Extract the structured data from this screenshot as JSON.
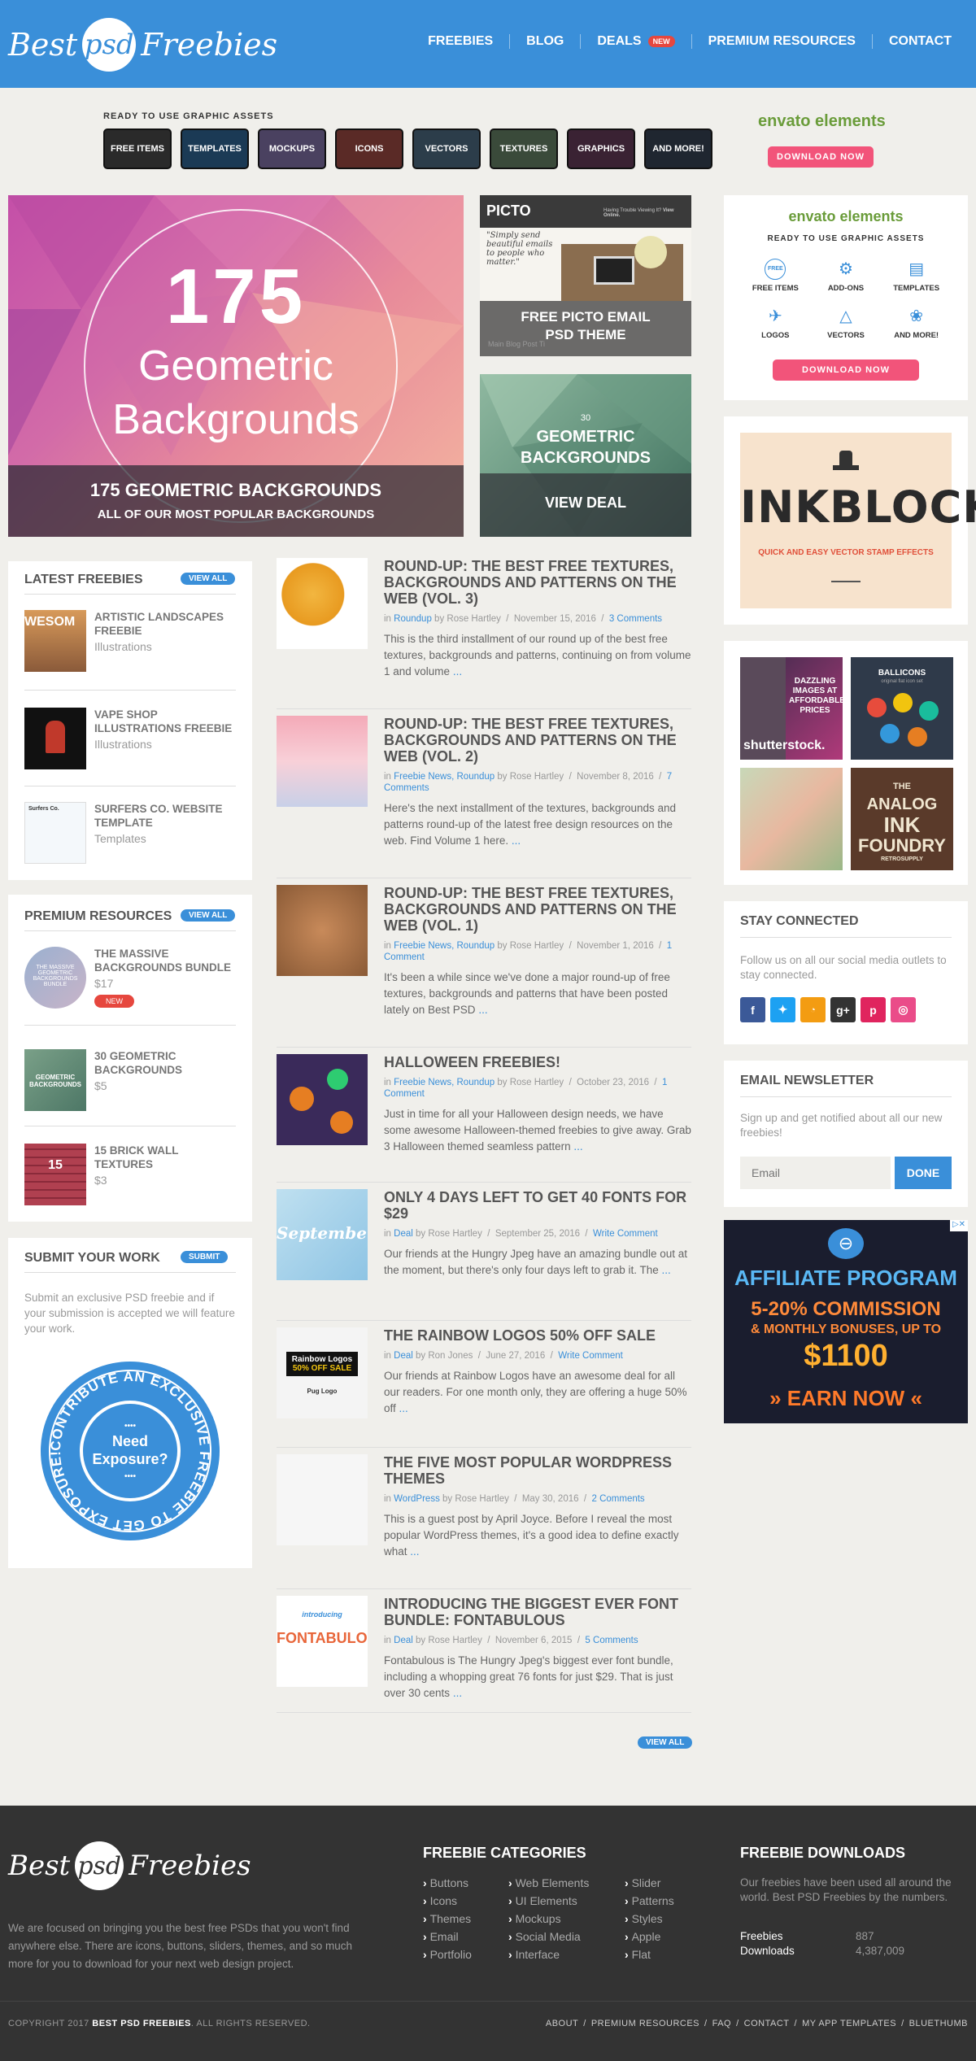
{
  "header": {
    "logo_left": "Best",
    "logo_mid": "psd",
    "logo_right": "Freebies",
    "nav": [
      {
        "label": "FREEBIES"
      },
      {
        "label": "BLOG"
      },
      {
        "label": "DEALS",
        "badge": "NEW"
      },
      {
        "label": "PREMIUM RESOURCES"
      },
      {
        "label": "CONTACT"
      }
    ]
  },
  "assets": {
    "label": "READY TO USE GRAPHIC ASSETS",
    "tiles": [
      "FREE ITEMS",
      "TEMPLATES",
      "MOCKUPS",
      "ICONS",
      "VECTORS",
      "TEXTURES",
      "GRAPHICS",
      "AND MORE!"
    ],
    "brand": "envato elements",
    "button": "DOWNLOAD NOW"
  },
  "hero": {
    "big": {
      "number": "175",
      "line1": "Geometric",
      "line2": "Backgrounds",
      "title": "175 GEOMETRIC BACKGROUNDS",
      "subtitle": "ALL OF OUR MOST POPULAR BACKGROUNDS"
    },
    "picto": {
      "brand": "PICTO",
      "tag": "Having Trouble Viewing It?",
      "tag2": "View Online.",
      "body": "\"Simply send beautiful emails to people who matter.\"",
      "title1": "FREE PICTO EMAIL",
      "title2": "PSD THEME",
      "footer": "Main Blog Post Ti"
    },
    "deal": {
      "small1": "30",
      "small2": "GEOMETRIC",
      "small3": "BACKGROUNDS",
      "title": "VIEW DEAL"
    }
  },
  "envato_panel": {
    "brand": "envato elements",
    "sub": "READY TO USE GRAPHIC ASSETS",
    "items": [
      "FREE ITEMS",
      "ADD-ONS",
      "TEMPLATES",
      "LOGOS",
      "VECTORS",
      "AND MORE!"
    ],
    "free": "FREE",
    "button": "DOWNLOAD NOW"
  },
  "inkblock": {
    "title": "INKBLOCK",
    "sub": "QUICK AND EASY VECTOR STAMP EFFECTS"
  },
  "ads": {
    "shutter1": "DAZZLING",
    "shutter2": "IMAGES AT",
    "shutter3": "AFFORDABLE",
    "shutter4": "PRICES",
    "shutter_brand": "shutterstock.",
    "ballicons": "BALLICONS",
    "ballicons_sub": "original flat icon set",
    "analog1": "THE",
    "analog2": "ANALOG",
    "analog3": "INK",
    "analog4": "FOUNDRY",
    "analog5": "RETROSUPPLY"
  },
  "latest": {
    "title": "LATEST FREEBIES",
    "viewall": "VIEW ALL",
    "items": [
      {
        "title": "ARTISTIC LANDSCAPES FREEBIE",
        "cat": "Illustrations",
        "thumb": "WESOM"
      },
      {
        "title": "VAPE SHOP ILLUSTRATIONS FREEBIE",
        "cat": "Illustrations"
      },
      {
        "title": "SURFERS CO. WEBSITE TEMPLATE",
        "cat": "Templates",
        "thumb": "Surfers Co."
      }
    ]
  },
  "premium": {
    "title": "PREMIUM RESOURCES",
    "viewall": "VIEW ALL",
    "items": [
      {
        "title": "THE MASSIVE BACKGROUNDS BUNDLE",
        "price": "$17",
        "badge": "NEW",
        "thumb": "THE MASSIVE GEOMETRIC BACKGROUNDS BUNDLE"
      },
      {
        "title": "30 GEOMETRIC BACKGROUNDS",
        "price": "$5",
        "thumb": "GEOMETRIC BACKGROUNDS"
      },
      {
        "title": "15 BRICK WALL TEXTURES",
        "price": "$3",
        "thumb": "15"
      }
    ]
  },
  "submit": {
    "title": "SUBMIT YOUR WORK",
    "button": "SUBMIT",
    "text": "Submit an exclusive PSD freebie and if your submission is accepted we will feature your work.",
    "badge1": "Need",
    "badge2": "Exposure?",
    "ring": "CONTRIBUTE AN EXCLUSIVE FREEBIE TO GET EXPOSURE!"
  },
  "posts": [
    {
      "title": "ROUND-UP: THE BEST FREE TEXTURES, BACKGROUNDS AND PATTERNS ON THE WEB (VOL. 3)",
      "meta_in": "in",
      "cats": "Roundup",
      "by": "by Rose Hartley",
      "date": "November 15, 2016",
      "comments": "3 Comments",
      "excerpt": "This is the third installment of our round up of the best free textures, backgrounds and patterns, continuing on from volume 1 and volume",
      "more": "..."
    },
    {
      "title": "ROUND-UP: THE BEST FREE TEXTURES, BACKGROUNDS AND PATTERNS ON THE WEB (VOL. 2)",
      "meta_in": "in",
      "cats": "Freebie News, Roundup",
      "by": "by Rose Hartley",
      "date": "November 8, 2016",
      "comments": "7 Comments",
      "excerpt": "Here's the next installment of the textures, backgrounds and patterns round-up of the latest free design resources on the web. Find Volume 1 here.",
      "more": "..."
    },
    {
      "title": "ROUND-UP: THE BEST FREE TEXTURES, BACKGROUNDS AND PATTERNS ON THE WEB (VOL. 1)",
      "meta_in": "in",
      "cats": "Freebie News, Roundup",
      "by": "by Rose Hartley",
      "date": "November 1, 2016",
      "comments": "1 Comment",
      "excerpt": "It's been a while since we've done a major round-up of free textures, backgrounds and patterns that have been posted lately on Best PSD",
      "more": "..."
    },
    {
      "title": "HALLOWEEN FREEBIES!",
      "meta_in": "in",
      "cats": "Freebie News, Roundup",
      "by": "by Rose Hartley",
      "date": "October 23, 2016",
      "comments": "1 Comment",
      "excerpt": "Just in time for all your Halloween design needs, we have some awesome Halloween-themed freebies to give away. Grab 3 Halloween themed seamless pattern",
      "more": "..."
    },
    {
      "title": "ONLY 4 DAYS LEFT TO GET 40 FONTS FOR $29",
      "meta_in": "in",
      "cats": "Deal",
      "by": "by Rose Hartley",
      "date": "September 25, 2016",
      "comments": "Write Comment",
      "excerpt": "Our friends at the Hungry Jpeg have an amazing bundle out at the moment, but there's only four days left to grab it. The",
      "more": "...",
      "thumb": "September"
    },
    {
      "title": "THE RAINBOW LOGOS 50% OFF SALE",
      "meta_in": "in",
      "cats": "Deal",
      "by": "by Ron Jones",
      "date": "June 27, 2016",
      "comments": "Write Comment",
      "excerpt": "Our friends at Rainbow Logos have an awesome deal for all our readers. For one month only, they are offering a huge 50% off",
      "more": "...",
      "thumb": "Rainbow Logos",
      "thumb2": "50% OFF SALE",
      "thumb3": "Pug Logo"
    },
    {
      "title": "THE FIVE MOST POPULAR WORDPRESS THEMES",
      "meta_in": "in",
      "cats": "WordPress",
      "by": "by Rose Hartley",
      "date": "May 30, 2016",
      "comments": "2 Comments",
      "excerpt": "This is a guest post by April Joyce.  Before I reveal the most popular WordPress themes, it's a good idea to define exactly what",
      "more": "..."
    },
    {
      "title": "INTRODUCING THE BIGGEST EVER FONT BUNDLE: FONTABULOUS",
      "meta_in": "in",
      "cats": "Deal",
      "by": "by Rose Hartley",
      "date": "November 6, 2015",
      "comments": "5 Comments",
      "excerpt": "Fontabulous is The Hungry Jpeg's biggest ever font bundle, including a whopping great 76 fonts for just $29. That is just over 30 cents",
      "more": "...",
      "thumb": "introducing",
      "thumb2": "FONTABULOU"
    }
  ],
  "posts_viewall": "VIEW ALL",
  "social": {
    "title": "STAY CONNECTED",
    "text": "Follow us on all our social media outlets to stay connected.",
    "icons": [
      "f",
      "t",
      "rss",
      "g+",
      "p",
      "dr"
    ],
    "colors": [
      "#3b5998",
      "#1da1f2",
      "#f39c12",
      "#333333",
      "#e0245e",
      "#ea4c89"
    ]
  },
  "newsletter": {
    "title": "EMAIL NEWSLETTER",
    "text": "Sign up and get notified about all our new freebies!",
    "placeholder": "Email",
    "button": "DONE"
  },
  "affiliate": {
    "title": "AFFILIATE PROGRAM",
    "line1": "5-20% COMMISSION",
    "line2": "& MONTHLY BONUSES, UP TO",
    "amount": "$1100",
    "cta": "EARN NOW"
  },
  "footer": {
    "about": "We are focused on bringing you the best free PSDs that you won't find anywhere else. There are icons, buttons, sliders, themes, and so much more for you to download for your next web design project.",
    "cat_title": "FREEBIE CATEGORIES",
    "cats1": [
      "Buttons",
      "Icons",
      "Themes",
      "Email",
      "Portfolio"
    ],
    "cats2": [
      "Web Elements",
      "UI Elements",
      "Mockups",
      "Social Media",
      "Interface"
    ],
    "cats3": [
      "Slider",
      "Patterns",
      "Styles",
      "Apple",
      "Flat"
    ],
    "dl_title": "FREEBIE DOWNLOADS",
    "dl_text": "Our freebies have been used all around the world. Best PSD Freebies by the numbers.",
    "stats": [
      {
        "label": "Freebies",
        "value": "887"
      },
      {
        "label": "Downloads",
        "value": "4,387,009"
      }
    ],
    "copyright_pre": "COPYRIGHT 2017",
    "copyright_brand": "BEST PSD FREEBIES",
    "copyright_post": ". ALL RIGHTS RESERVED.",
    "links": [
      "ABOUT",
      "PREMIUM RESOURCES",
      "FAQ",
      "CONTACT",
      "MY APP TEMPLATES",
      "BLUETHUMB"
    ]
  }
}
